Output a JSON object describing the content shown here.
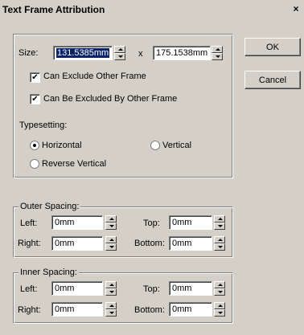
{
  "window": {
    "title": "Text Frame Attribution",
    "close_glyph": "×"
  },
  "size": {
    "label": "Size:",
    "width": "131.5385mm",
    "separator": "x",
    "height": "175.1538mm"
  },
  "options": {
    "can_exclude_other_frame": {
      "label": "Can Exclude Other Frame",
      "checked": true
    },
    "can_be_excluded": {
      "label": "Can Be Excluded By Other Frame",
      "checked": true
    }
  },
  "typesetting": {
    "label": "Typesetting:",
    "horizontal": "Horizontal",
    "vertical": "Vertical",
    "reverse_vertical": "Reverse Vertical",
    "selected": "Horizontal"
  },
  "outer_spacing": {
    "legend": "Outer Spacing:",
    "left_label": "Left:",
    "left_value": "0mm",
    "top_label": "Top:",
    "top_value": "0mm",
    "right_label": "Right:",
    "right_value": "0mm",
    "bottom_label": "Bottom:",
    "bottom_value": "0mm"
  },
  "inner_spacing": {
    "legend": "Inner Spacing:",
    "left_label": "Left:",
    "left_value": "0mm",
    "top_label": "Top:",
    "top_value": "0mm",
    "right_label": "Right:",
    "right_value": "0mm",
    "bottom_label": "Bottom:",
    "bottom_value": "0mm"
  },
  "buttons": {
    "ok": "OK",
    "cancel": "Cancel"
  }
}
